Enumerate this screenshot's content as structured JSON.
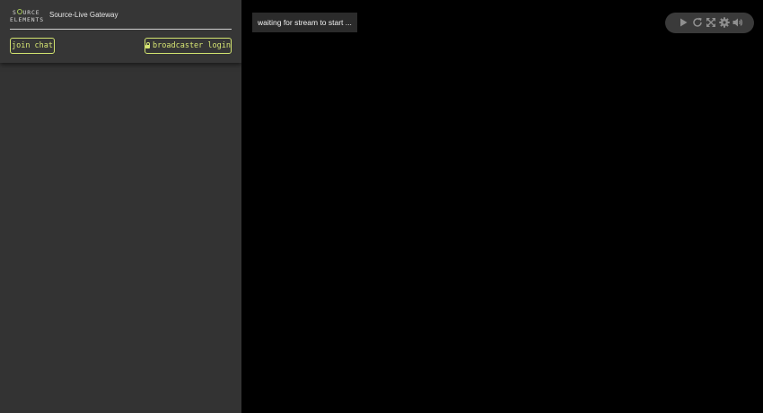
{
  "brand": {
    "logo_line1": "S   URCE",
    "logo_line2": "ELEMENTS",
    "app_title": "Source-Live Gateway"
  },
  "sidebar": {
    "join_chat_label": "join chat",
    "broadcaster_login_label": "broadcaster login"
  },
  "player": {
    "status_text": "waiting for stream to start ...",
    "controls": [
      {
        "icon": "play-icon",
        "label": "play"
      },
      {
        "icon": "reload-icon",
        "label": "reload"
      },
      {
        "icon": "fullscreen-icon",
        "label": "fullscreen"
      },
      {
        "icon": "gear-icon",
        "label": "settings"
      },
      {
        "icon": "volume-icon",
        "label": "volume"
      }
    ]
  },
  "colors": {
    "accent": "#d2e36f",
    "sidebar_bg": "#333333",
    "player_bg": "#000000",
    "control_bar_bg": "#3a3a3a",
    "icon_color": "#9a9a9a"
  }
}
